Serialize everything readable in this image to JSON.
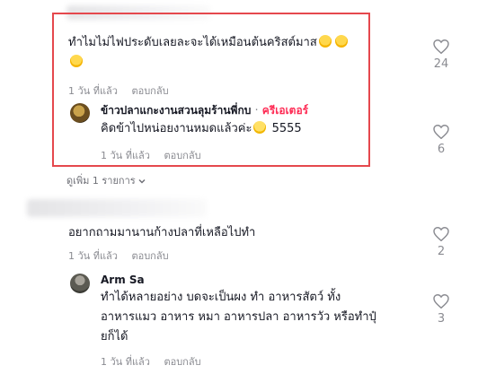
{
  "comments": [
    {
      "text": "ทำไมไม่ไฟประดับเลยละจะได้เหมือนต้นคริสต์มาส",
      "time": "1 วัน ที่แล้ว",
      "reply_label": "ตอบกลับ",
      "likes": "24",
      "reply": {
        "author": "ข้าวปลาแกะงานสวนลุมร้านพี่กบ",
        "separator": "·",
        "badge": "ครีเอเตอร์",
        "text": "คิดข้าไปหน่อยงานหมดแล้วค่ะ",
        "text_suffix": "5555",
        "time": "1 วัน ที่แล้ว",
        "reply_label": "ตอบกลับ",
        "likes": "6"
      },
      "more_replies": "ดูเพิ่ม 1 รายการ"
    },
    {
      "text": "อยากถามมานานก้างปลาที่เหลือไปทำ",
      "time": "1 วัน ที่แล้ว",
      "reply_label": "ตอบกลับ",
      "likes": "2",
      "reply": {
        "author": "Arm Sa",
        "text_lines": [
          "ทำได้หลายอย่าง บดจะเป็นผง ทำ อาหารสัตว์ ทั้ง",
          "อาหารแมว อาหาร หมา อาหารปลา อาหารวัว หรือทำปุ๋",
          "ยก็ได้"
        ],
        "time": "1 วัน ที่แล้ว",
        "reply_label": "ตอบกลับ",
        "likes": "3"
      }
    }
  ],
  "icons": {
    "like": "heart-outline-icon",
    "expand": "chevron-down-icon",
    "emoji": "rofl-emoji"
  },
  "colors": {
    "highlight": "#e5484d",
    "creator_badge": "#fe2c55",
    "muted": "#8a8b91"
  }
}
